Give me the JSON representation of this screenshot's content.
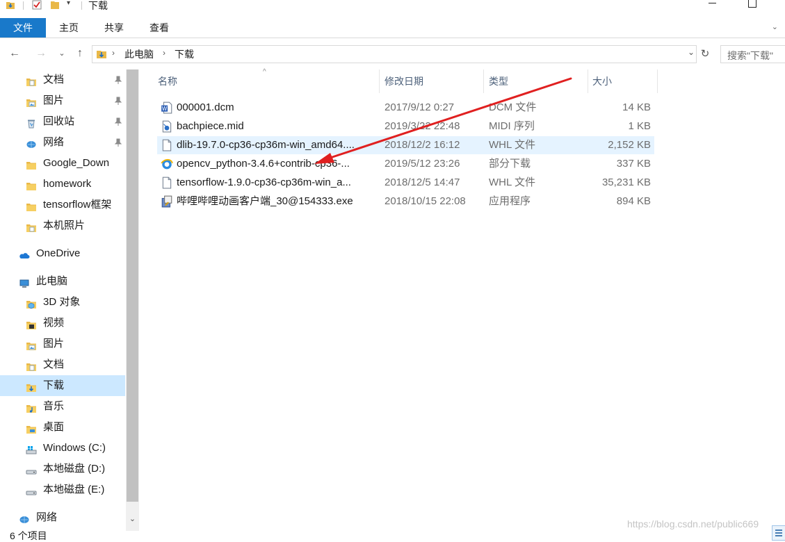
{
  "window": {
    "title": "下载"
  },
  "ribbon": {
    "tabs": [
      {
        "label": "文件"
      },
      {
        "label": "主页"
      },
      {
        "label": "共享"
      },
      {
        "label": "查看"
      }
    ]
  },
  "nav": {
    "breadcrumb": [
      "此电脑",
      "下载"
    ],
    "search_placeholder": "搜索\"下载\""
  },
  "sidebar": {
    "items": [
      {
        "label": "文档",
        "icon": "documents-folder-icon",
        "pinned": true
      },
      {
        "label": "图片",
        "icon": "pictures-folder-icon",
        "pinned": true
      },
      {
        "label": "回收站",
        "icon": "recycle-bin-icon",
        "pinned": true
      },
      {
        "label": "网络",
        "icon": "network-icon",
        "pinned": true
      },
      {
        "label": "Google_Down",
        "icon": "folder-icon"
      },
      {
        "label": "homework",
        "icon": "folder-icon"
      },
      {
        "label": "tensorflow框架",
        "icon": "folder-icon"
      },
      {
        "label": "本机照片",
        "icon": "photos-folder-icon"
      },
      {
        "label": "OneDrive",
        "icon": "onedrive-cloud-icon"
      },
      {
        "label": "此电脑",
        "icon": "this-pc-icon"
      },
      {
        "label": "3D 对象",
        "icon": "3d-objects-icon"
      },
      {
        "label": "视频",
        "icon": "videos-folder-icon"
      },
      {
        "label": "图片",
        "icon": "pictures-folder-icon"
      },
      {
        "label": "文档",
        "icon": "documents-folder-icon"
      },
      {
        "label": "下载",
        "icon": "downloads-folder-icon",
        "selected": true
      },
      {
        "label": "音乐",
        "icon": "music-folder-icon"
      },
      {
        "label": "桌面",
        "icon": "desktop-folder-icon"
      },
      {
        "label": "Windows (C:)",
        "icon": "windows-drive-icon"
      },
      {
        "label": "本地磁盘 (D:)",
        "icon": "drive-icon"
      },
      {
        "label": "本地磁盘 (E:)",
        "icon": "drive-icon"
      },
      {
        "label": "网络",
        "icon": "network-icon"
      }
    ]
  },
  "columns": [
    "名称",
    "修改日期",
    "类型",
    "大小"
  ],
  "files": [
    {
      "name": "000001.dcm",
      "date": "2017/9/12 0:27",
      "type": "DCM 文件",
      "size": "14 KB",
      "icon": "word-doc-icon"
    },
    {
      "name": "bachpiece.mid",
      "date": "2019/3/22 22:48",
      "type": "MIDI 序列",
      "size": "1 KB",
      "icon": "midi-file-icon"
    },
    {
      "name": "dlib-19.7.0-cp36-cp36m-win_amd64....",
      "date": "2018/12/2 16:12",
      "type": "WHL 文件",
      "size": "2,152 KB",
      "icon": "blank-file-icon",
      "selected": true
    },
    {
      "name": "opencv_python-3.4.6+contrib-cp36-...",
      "date": "2019/5/12 23:26",
      "type": "部分下载",
      "size": "337 KB",
      "icon": "ie-partial-download-icon"
    },
    {
      "name": "tensorflow-1.9.0-cp36-cp36m-win_a...",
      "date": "2018/12/5 14:47",
      "type": "WHL 文件",
      "size": "35,231 KB",
      "icon": "blank-file-icon"
    },
    {
      "name": "哔哩哔哩动画客户端_30@154333.exe",
      "date": "2018/10/15 22:08",
      "type": "应用程序",
      "size": "894 KB",
      "icon": "installer-exe-icon"
    }
  ],
  "status": {
    "item_count": "6 个项目"
  },
  "watermark": "https://blog.csdn.net/public669",
  "colors": {
    "file_tab": "#1979ca",
    "selection": "#cce8ff",
    "annotation_arrow": "#e02020"
  }
}
